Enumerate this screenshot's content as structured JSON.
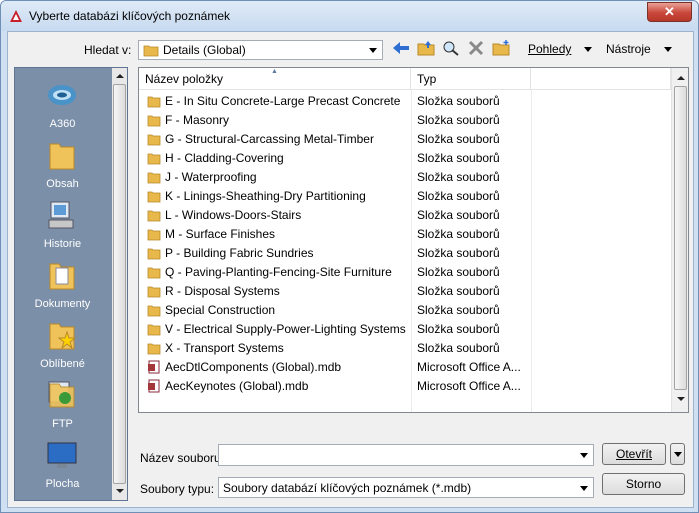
{
  "window": {
    "title": "Vyberte databázi klíčových poznámek"
  },
  "toolbar": {
    "look_in_label": "Hledat v:",
    "look_in_value": "Details (Global)",
    "views_label": "Pohledy",
    "tools_label": "Nástroje"
  },
  "places": [
    {
      "label": "A360",
      "icon": "a360-icon"
    },
    {
      "label": "Obsah",
      "icon": "folder-icon"
    },
    {
      "label": "Historie",
      "icon": "history-icon"
    },
    {
      "label": "Dokumenty",
      "icon": "documents-icon"
    },
    {
      "label": "Oblíbené",
      "icon": "favorites-icon"
    },
    {
      "label": "FTP",
      "icon": "ftp-icon"
    },
    {
      "label": "Plocha",
      "icon": "desktop-icon"
    }
  ],
  "list": {
    "columns": [
      "Název položky",
      "Typ"
    ],
    "items": [
      {
        "name": "E - In Situ Concrete-Large Precast Concrete",
        "type": "Složka souborů",
        "icon": "folder"
      },
      {
        "name": "F - Masonry",
        "type": "Složka souborů",
        "icon": "folder"
      },
      {
        "name": "G - Structural-Carcassing Metal-Timber",
        "type": "Složka souborů",
        "icon": "folder"
      },
      {
        "name": "H - Cladding-Covering",
        "type": "Složka souborů",
        "icon": "folder"
      },
      {
        "name": "J - Waterproofing",
        "type": "Složka souborů",
        "icon": "folder"
      },
      {
        "name": "K - Linings-Sheathing-Dry Partitioning",
        "type": "Složka souborů",
        "icon": "folder"
      },
      {
        "name": "L - Windows-Doors-Stairs",
        "type": "Složka souborů",
        "icon": "folder"
      },
      {
        "name": "M - Surface Finishes",
        "type": "Složka souborů",
        "icon": "folder"
      },
      {
        "name": "P - Building Fabric Sundries",
        "type": "Složka souborů",
        "icon": "folder"
      },
      {
        "name": "Q - Paving-Planting-Fencing-Site Furniture",
        "type": "Složka souborů",
        "icon": "folder"
      },
      {
        "name": "R - Disposal Systems",
        "type": "Složka souborů",
        "icon": "folder"
      },
      {
        "name": "Special Construction",
        "type": "Složka souborů",
        "icon": "folder"
      },
      {
        "name": "V - Electrical Supply-Power-Lighting Systems",
        "type": "Složka souborů",
        "icon": "folder"
      },
      {
        "name": "X - Transport Systems",
        "type": "Složka souborů",
        "icon": "folder"
      },
      {
        "name": "AecDtlComponents (Global).mdb",
        "type": "Microsoft Office A...",
        "icon": "mdb"
      },
      {
        "name": "AecKeynotes (Global).mdb",
        "type": "Microsoft Office A...",
        "icon": "mdb"
      }
    ]
  },
  "footer": {
    "filename_label": "Název souboru:",
    "filename_value": "",
    "filetype_label": "Soubory typu:",
    "filetype_value": "Soubory databází klíčových poznámek (*.mdb)",
    "open_label": "Otevřít",
    "cancel_label": "Storno"
  },
  "colors": {
    "title_bg": "#cfe0f3",
    "places_bg": "#7b8fa8",
    "folder": "#e8b84a",
    "close": "#c9463a"
  }
}
